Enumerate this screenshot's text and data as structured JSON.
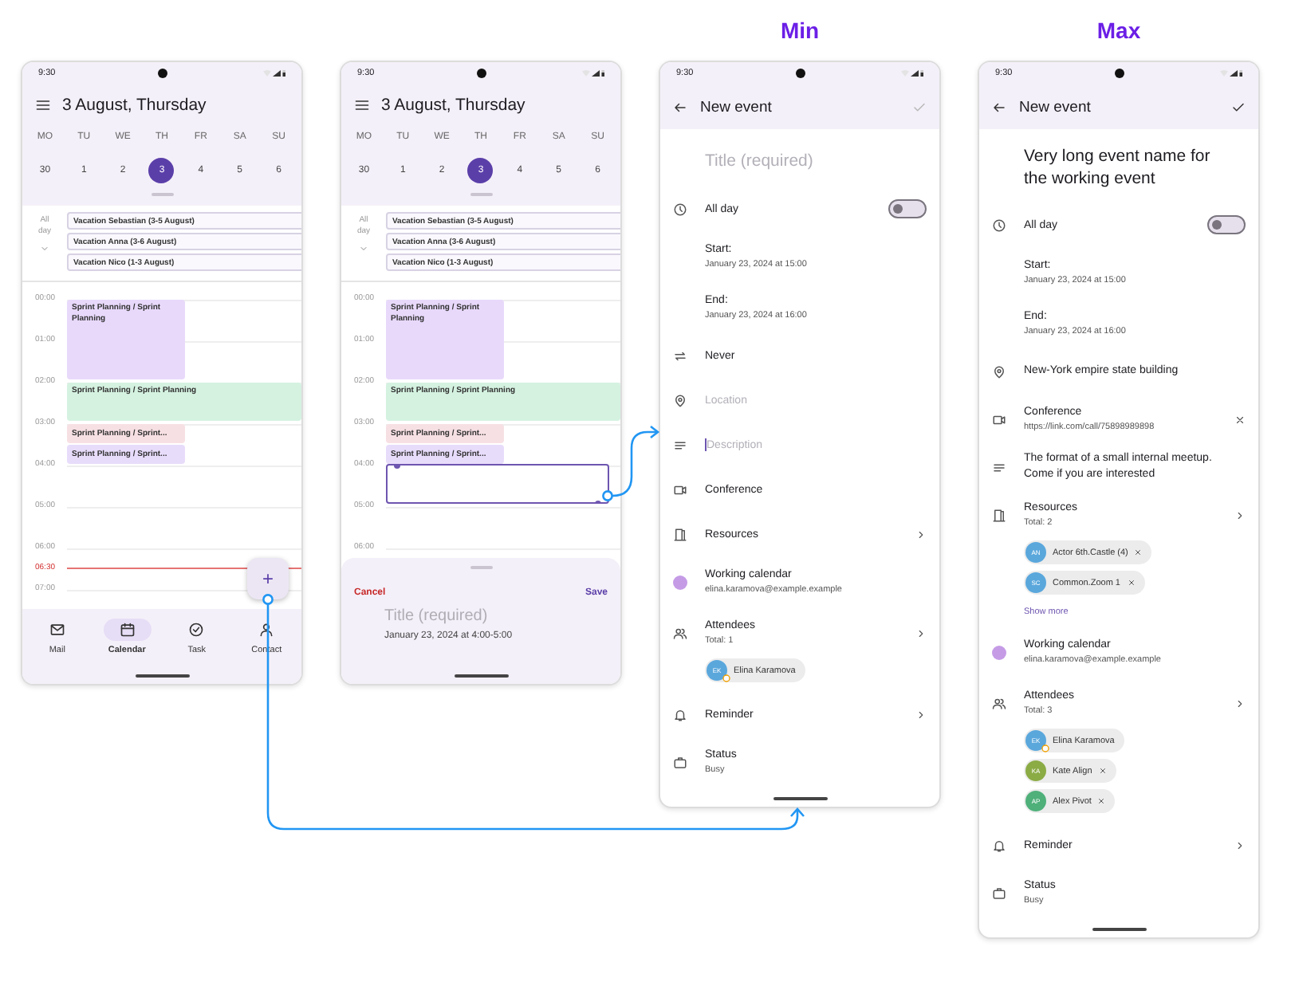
{
  "screens": [
    {
      "kind": "day_view",
      "status_time": "9:30",
      "title": "3 August, Thursday",
      "week": [
        {
          "day": "MO",
          "date": "30",
          "selected": false
        },
        {
          "day": "TU",
          "date": "1",
          "selected": false
        },
        {
          "day": "WE",
          "date": "2",
          "selected": false
        },
        {
          "day": "TH",
          "date": "3",
          "selected": true
        },
        {
          "day": "FR",
          "date": "4",
          "selected": false
        },
        {
          "day": "SA",
          "date": "5",
          "selected": false
        },
        {
          "day": "SU",
          "date": "6",
          "selected": false
        }
      ],
      "all_day_label": "All day",
      "all_day_events": [
        "Vacation Sebastian (3-5 August)",
        "Vacation Anna (3-6 August)",
        "Vacation Nico (1-3 August)"
      ],
      "hours": [
        {
          "label": "00:00",
          "kind": "hour"
        },
        {
          "label": "01:00",
          "kind": "hour"
        },
        {
          "label": "02:00",
          "kind": "hour"
        },
        {
          "label": "03:00",
          "kind": "hour"
        },
        {
          "label": "04:00",
          "kind": "hour"
        },
        {
          "label": "05:00",
          "kind": "hour"
        },
        {
          "label": "06:00",
          "kind": "hour"
        },
        {
          "label": "06:30",
          "kind": "now"
        },
        {
          "label": "07:00",
          "kind": "hour"
        }
      ],
      "events": [
        {
          "kind": "tall",
          "title": "Sprint Planning / Sprint Planning",
          "color": "#e8d9fb"
        },
        {
          "kind": "wide",
          "title": "Sprint Planning / Sprint Planning",
          "color": "#d5f2e1"
        },
        {
          "kind": "short",
          "title": "Sprint Planning / Sprint...",
          "color": "#f7e0e4"
        },
        {
          "kind": "short",
          "title": "Sprint Planning / Sprint...",
          "color": "#e8dcfb"
        }
      ],
      "fab": "+",
      "bottom_nav": [
        {
          "label": "Mail",
          "selected": false
        },
        {
          "label": "Calendar",
          "selected": true
        },
        {
          "label": "Task",
          "selected": false
        },
        {
          "label": "Contact",
          "selected": false
        }
      ]
    },
    {
      "kind": "day_view",
      "status_time": "9:30",
      "title": "3 August, Thursday",
      "week": [
        {
          "day": "MO",
          "date": "30",
          "selected": false
        },
        {
          "day": "TU",
          "date": "1",
          "selected": false
        },
        {
          "day": "WE",
          "date": "2",
          "selected": false
        },
        {
          "day": "TH",
          "date": "3",
          "selected": true
        },
        {
          "day": "FR",
          "date": "4",
          "selected": false
        },
        {
          "day": "SA",
          "date": "5",
          "selected": false
        },
        {
          "day": "SU",
          "date": "6",
          "selected": false
        }
      ],
      "all_day_label": "All day",
      "all_day_events": [
        "Vacation Sebastian (3-5 August)",
        "Vacation Anna (3-6 August)",
        "Vacation Nico (1-3 August)"
      ],
      "hours": [
        {
          "label": "00:00",
          "kind": "hour"
        },
        {
          "label": "01:00",
          "kind": "hour"
        },
        {
          "label": "02:00",
          "kind": "hour"
        },
        {
          "label": "03:00",
          "kind": "hour"
        },
        {
          "label": "04:00",
          "kind": "hour"
        },
        {
          "label": "05:00",
          "kind": "hour"
        },
        {
          "label": "06:00",
          "kind": "hour"
        }
      ],
      "events": [
        {
          "kind": "tall",
          "title": "Sprint Planning / Sprint Planning",
          "color": "#e8d9fb"
        },
        {
          "kind": "wide",
          "title": "Sprint Planning / Sprint Planning",
          "color": "#d5f2e1"
        },
        {
          "kind": "short",
          "title": "Sprint Planning / Sprint...",
          "color": "#f7e0e4"
        },
        {
          "kind": "short",
          "title": "Sprint Planning / Sprint...",
          "color": "#e8dcfb"
        },
        {
          "kind": "draft"
        }
      ],
      "sheet": {
        "cancel": "Cancel",
        "save": "Save",
        "title_placeholder": "Title (required)",
        "time": "January 23, 2024 at 4:00-5:00"
      }
    },
    {
      "kind": "event_form",
      "heading": "Min",
      "status_time": "9:30",
      "title": "New event",
      "save_enabled": false,
      "title_field": {
        "placeholder": "Title (required)"
      },
      "rows": [
        {
          "kind": "toggle",
          "label": "All day",
          "on": false
        },
        {
          "kind": "datetime",
          "label": "Start:",
          "detail": "January 23, 2024 at 15:00"
        },
        {
          "kind": "datetime",
          "label": "End:",
          "detail": "January 23, 2024 at 16:00"
        },
        {
          "kind": "repeat",
          "label": "Never"
        },
        {
          "kind": "location",
          "placeholder": "Location"
        },
        {
          "kind": "description",
          "placeholder": "Description",
          "focused": true
        },
        {
          "kind": "conference",
          "label": "Conference"
        },
        {
          "kind": "resources",
          "label": "Resources"
        },
        {
          "kind": "calendar",
          "label": "Working calendar",
          "detail": "elina.karamova@example.example",
          "color": "#c59be6"
        },
        {
          "kind": "attendees",
          "label": "Attendees",
          "detail": "Total: 1",
          "chips": [
            {
              "initials": "EK",
              "name": "Elina Karamova",
              "color": "#5aa7dc",
              "organizer": true,
              "removable": false
            }
          ]
        },
        {
          "kind": "reminder",
          "label": "Reminder"
        },
        {
          "kind": "status",
          "label": "Status",
          "detail": "Busy"
        }
      ]
    },
    {
      "kind": "event_form",
      "heading": "Max",
      "status_time": "9:30",
      "title": "New event",
      "save_enabled": true,
      "title_field": {
        "value": "Very long event name for the working event"
      },
      "rows": [
        {
          "kind": "toggle",
          "label": "All day",
          "on": false
        },
        {
          "kind": "datetime",
          "label": "Start:",
          "detail": "January 23, 2024 at 15:00"
        },
        {
          "kind": "datetime",
          "label": "End:",
          "detail": "January 23, 2024 at 16:00"
        },
        {
          "kind": "location",
          "value": "New-York empire state building"
        },
        {
          "kind": "conference",
          "label": "Conference",
          "detail": "https://link.com/call/75898989898",
          "removable": true
        },
        {
          "kind": "description",
          "value": "The format of a small internal meetup. Come if you are interested"
        },
        {
          "kind": "resources",
          "label": "Resources",
          "detail": "Total: 2",
          "chips": [
            {
              "initials": "AN",
              "name": "Actor 6th.Castle (4)",
              "color": "#5aa7dc",
              "organizer": false,
              "removable": true
            },
            {
              "initials": "SC",
              "name": "Common.Zoom 1",
              "color": "#5aa7dc",
              "organizer": false,
              "removable": true
            }
          ],
          "show_more": "Show more"
        },
        {
          "kind": "calendar",
          "label": "Working calendar",
          "detail": "elina.karamova@example.example",
          "color": "#c59be6"
        },
        {
          "kind": "attendees",
          "label": "Attendees",
          "detail": "Total: 3",
          "chips": [
            {
              "initials": "EK",
              "name": "Elina Karamova",
              "color": "#5aa7dc",
              "organizer": true,
              "removable": false
            },
            {
              "initials": "KA",
              "name": "Kate Align",
              "color": "#8bab45",
              "organizer": false,
              "removable": true
            },
            {
              "initials": "AP",
              "name": "Alex Pivot",
              "color": "#4fb07a",
              "organizer": false,
              "removable": true
            }
          ]
        },
        {
          "kind": "reminder",
          "label": "Reminder"
        },
        {
          "kind": "status",
          "label": "Status",
          "detail": "Busy"
        }
      ]
    }
  ]
}
